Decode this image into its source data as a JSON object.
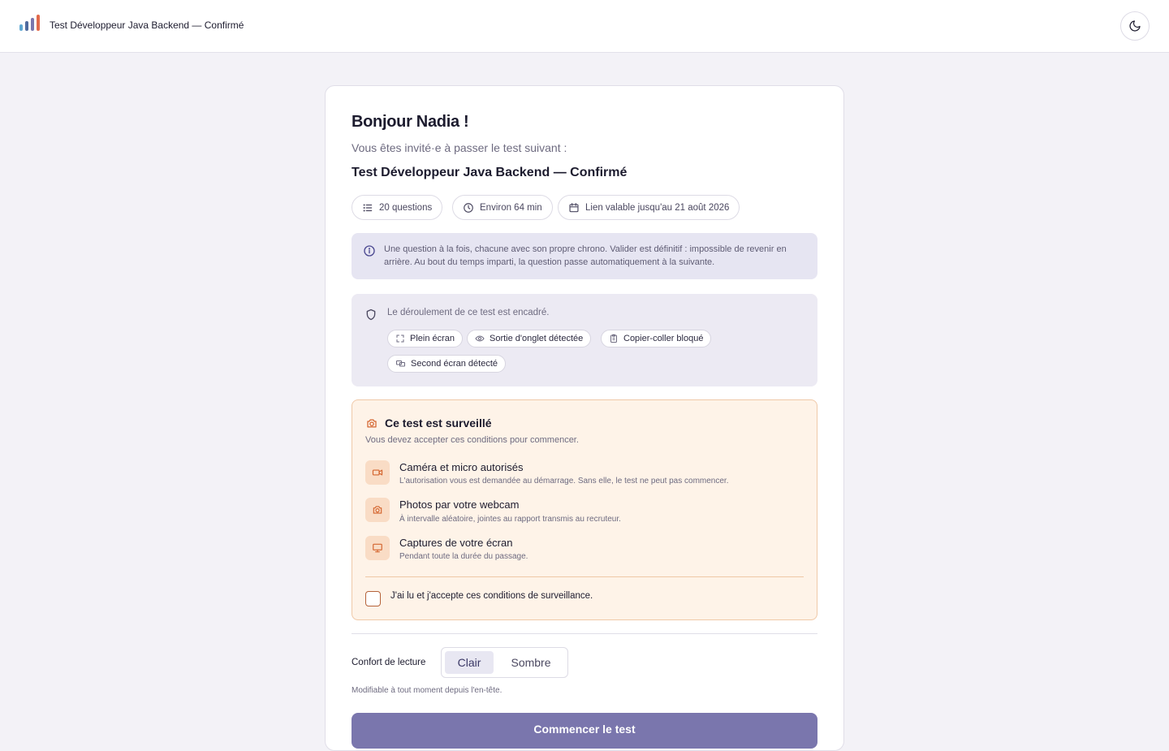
{
  "header": {
    "app_title": "Test Développeur Java Backend — Confirmé",
    "logo_colors": [
      "#5fa8d3",
      "#4f6a9e",
      "#7a76ad",
      "#e2694b"
    ]
  },
  "intro": {
    "greeting": "Bonjour Nadia !",
    "subtitle": "Vous êtes invité·e à passer le test suivant :",
    "test_name": "Test Développeur Java Backend — Confirmé"
  },
  "meta": {
    "questions": "20 questions",
    "duration": "Environ 64 min",
    "validity": "Lien valable jusqu'au 21 août 2026"
  },
  "info": {
    "text": "Une question à la fois, chacune avec son propre chrono. Valider est définitif : impossible de revenir en arrière. Au bout du temps imparti, la question passe automatiquement à la suivante."
  },
  "security": {
    "lead": "Le déroulement de ce test est encadré.",
    "fullscreen": "Plein écran",
    "tab_exit": "Sortie d'onglet détectée",
    "copy_paste": "Copier-coller bloqué",
    "second_screen": "Second écran détecté"
  },
  "surveillance": {
    "title": "Ce test est surveillé",
    "subtitle": "Vous devez accepter ces conditions pour commencer.",
    "items": [
      {
        "title": "Caméra et micro autorisés",
        "desc": "L'autorisation vous est demandée au démarrage. Sans elle, le test ne peut pas commencer."
      },
      {
        "title": "Photos par votre webcam",
        "desc": "À intervalle aléatoire, jointes au rapport transmis au recruteur."
      },
      {
        "title": "Captures de votre écran",
        "desc": "Pendant toute la durée du passage."
      }
    ],
    "accept_label": "J'ai lu et j'accepte ces conditions de surveillance.",
    "accent_color": "#d4652f"
  },
  "comfort": {
    "label": "Confort de lecture",
    "light": "Clair",
    "dark": "Sombre",
    "hint": "Modifiable à tout moment depuis l'en-tête."
  },
  "start_button": "Commencer le test"
}
